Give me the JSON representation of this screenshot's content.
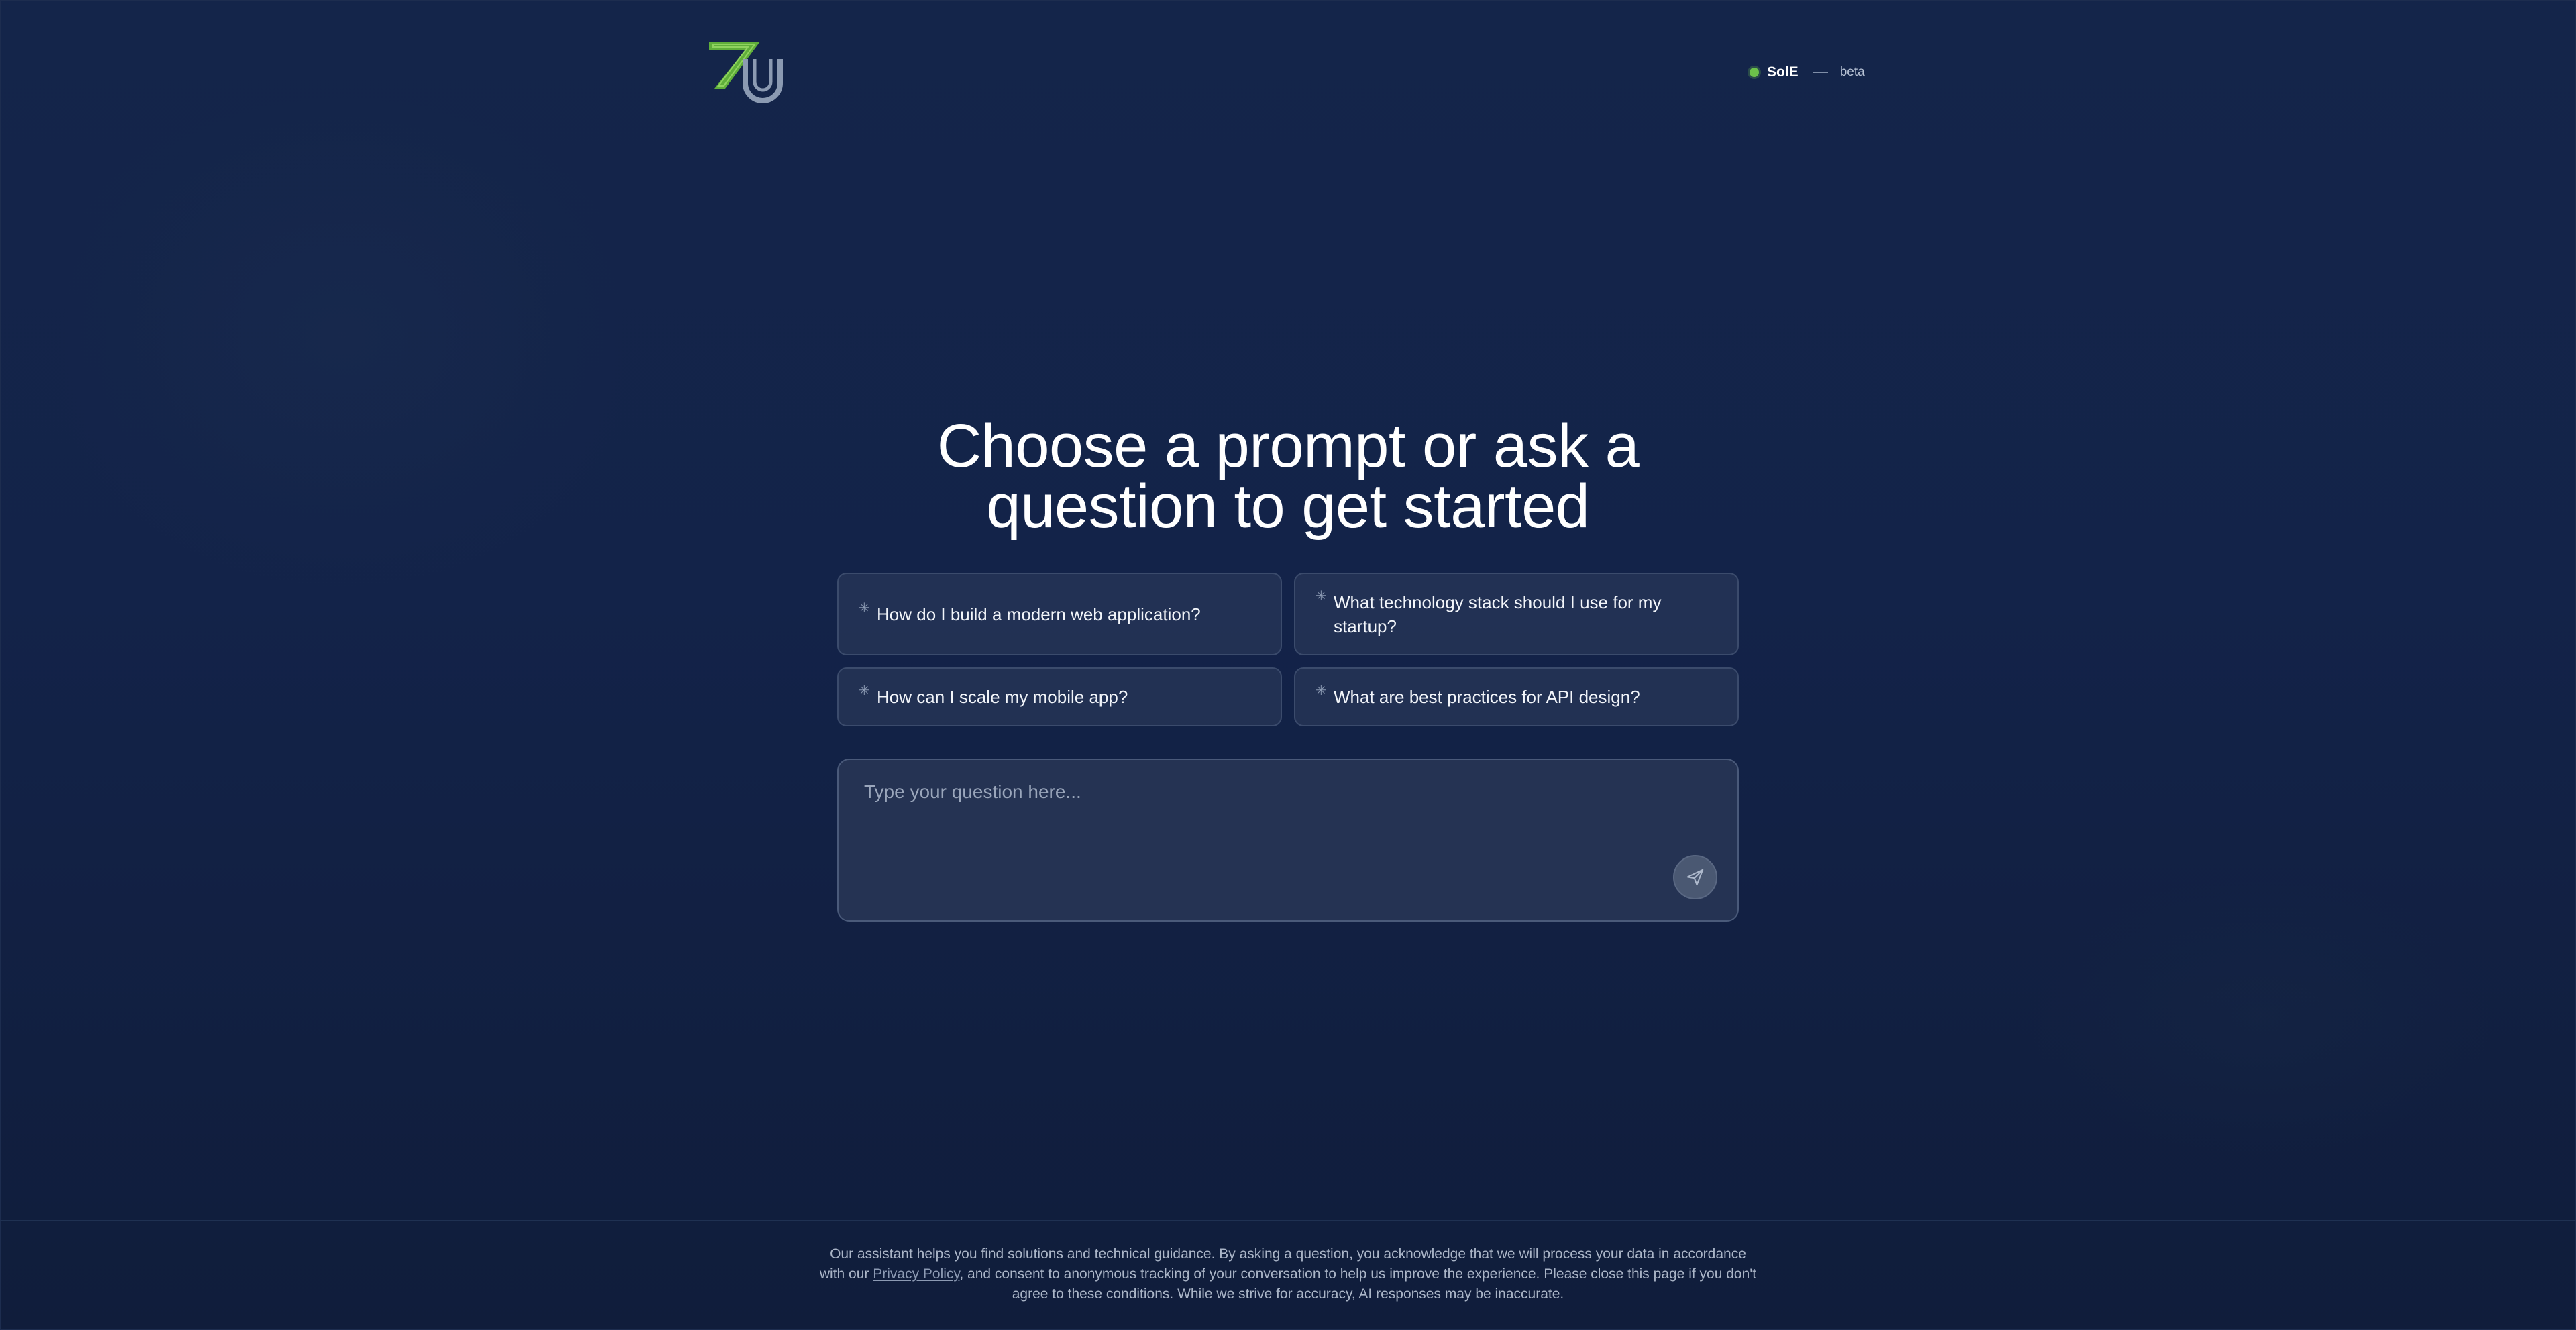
{
  "header": {
    "logo_icon": "7u-logo-icon",
    "status": {
      "name": "SolE",
      "beta": "beta",
      "dot_color": "#6cc24a"
    }
  },
  "main": {
    "headline_line1": "Choose a prompt or ask a",
    "headline_line2": "question to get started",
    "prompts": [
      {
        "label": "How do I build a modern web application?",
        "icon": "sparkle-icon"
      },
      {
        "label": "What technology stack should I use for my startup?",
        "icon": "sparkle-icon"
      },
      {
        "label": "How can I scale my mobile app?",
        "icon": "sparkle-icon"
      },
      {
        "label": "What are best practices for API design?",
        "icon": "sparkle-icon"
      }
    ],
    "input": {
      "placeholder": "Type your question here...",
      "value": "",
      "send_icon": "send-icon"
    }
  },
  "footer": {
    "text_before_link": "Our assistant helps you find solutions and technical guidance. By asking a question, you acknowledge that we will process your data in accordance with our ",
    "link_label": "Privacy Policy",
    "text_after_link": ", and consent to anonymous tracking of your conversation to help us improve the experience. Please close this page if you don't agree to these conditions. While we strive for accuracy, AI responses may be inaccurate."
  },
  "colors": {
    "background": "#14254a",
    "accent_green": "#6cc24a",
    "logo_grey": "#8b9ab2"
  }
}
